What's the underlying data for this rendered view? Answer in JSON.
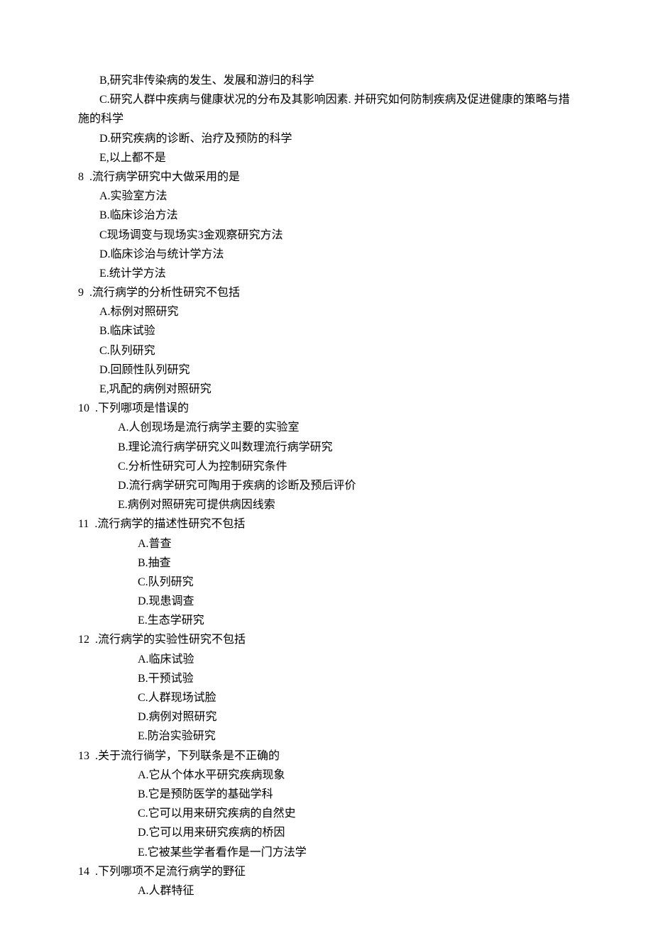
{
  "lines": [
    {
      "cls": "option-indent-1",
      "text": "B,研究非传染病的发生、发展和游归的科学"
    },
    {
      "cls": "option-indent-1",
      "text": "C.研究人群中疾病与健康状况的分布及其影响因素. 并研究如何防制疾病及促进健康的策略与措"
    },
    {
      "cls": "no-indent",
      "text": "施的科学"
    },
    {
      "cls": "option-indent-1",
      "text": "D.研究疾病的诊断、治疗及预防的科学"
    },
    {
      "cls": "option-indent-1",
      "text": "E,以上都不是"
    },
    {
      "cls": "q-line",
      "text": "8  .流行病学研究中大做采用的是"
    },
    {
      "cls": "option-indent-1",
      "text": "A.实验室方法"
    },
    {
      "cls": "option-indent-1",
      "text": "B.临床诊治方法"
    },
    {
      "cls": "option-indent-1",
      "text": "C现场调变与现场实3金观察研究方法"
    },
    {
      "cls": "option-indent-1",
      "text": "D.临床诊治与统计学方法"
    },
    {
      "cls": "option-indent-1",
      "text": "E.统计学方法"
    },
    {
      "cls": "q-line",
      "text": "9  .流行病学的分析性研究不包括"
    },
    {
      "cls": "option-indent-1",
      "text": "A.标例对照研究"
    },
    {
      "cls": "option-indent-1",
      "text": "B.临床试验"
    },
    {
      "cls": "option-indent-1",
      "text": "C.队列研究"
    },
    {
      "cls": "option-indent-1",
      "text": "D.回顾性队列研究"
    },
    {
      "cls": "option-indent-1",
      "text": "E,巩配的病例对照研究"
    },
    {
      "cls": "q-line",
      "text": "10  .下列哪项是惜误的"
    },
    {
      "cls": "option-indent-2",
      "text": "A.人创现场是流行病学主要的实验室"
    },
    {
      "cls": "option-indent-2",
      "text": "B.理论流行病学研究义叫数理流行病学研究"
    },
    {
      "cls": "option-indent-2",
      "text": "C.分析性研究可人为控制研究条件"
    },
    {
      "cls": "option-indent-2",
      "text": "D.流行病学研究可陶用于疾病的诊断及预后评价"
    },
    {
      "cls": "option-indent-2",
      "text": "E.病例对照研宪可提供病因线索"
    },
    {
      "cls": "q-line",
      "text": "11  .流行病学的描述性研究不包括"
    },
    {
      "cls": "option-indent-3",
      "text": "A.普查"
    },
    {
      "cls": "option-indent-3",
      "text": "B.抽查"
    },
    {
      "cls": "option-indent-3",
      "text": "C.队列研究"
    },
    {
      "cls": "option-indent-3",
      "text": "D.现患调查"
    },
    {
      "cls": "option-indent-3",
      "text": "E.生态学研究"
    },
    {
      "cls": "q-line",
      "text": "12  .流行病学的实验性研究不包括"
    },
    {
      "cls": "option-indent-3",
      "text": "A.临床试验"
    },
    {
      "cls": "option-indent-3",
      "text": "B.干预试验"
    },
    {
      "cls": "option-indent-3",
      "text": "C.人群现场试脸"
    },
    {
      "cls": "option-indent-3",
      "text": "D.病例对照研究"
    },
    {
      "cls": "option-indent-3",
      "text": "E.防治实验研究"
    },
    {
      "cls": "q-line",
      "text": "13  .关于流行徜学，下列联条是不正确的"
    },
    {
      "cls": "option-indent-3",
      "text": "A.它从个体水平研究疾病现象"
    },
    {
      "cls": "option-indent-3",
      "text": "B.它是预防医学的基础学科"
    },
    {
      "cls": "option-indent-3",
      "text": "C.它可以用来研究疾病的自然史"
    },
    {
      "cls": "option-indent-3",
      "text": "D.它可以用来研究疾病的桥因"
    },
    {
      "cls": "option-indent-3",
      "text": "E.它被某些学者看作是一门方法学"
    },
    {
      "cls": "q-line",
      "text": "14  .下列哪项不足流行病学的野征"
    },
    {
      "cls": "option-indent-3",
      "text": "A.人群特征"
    }
  ]
}
